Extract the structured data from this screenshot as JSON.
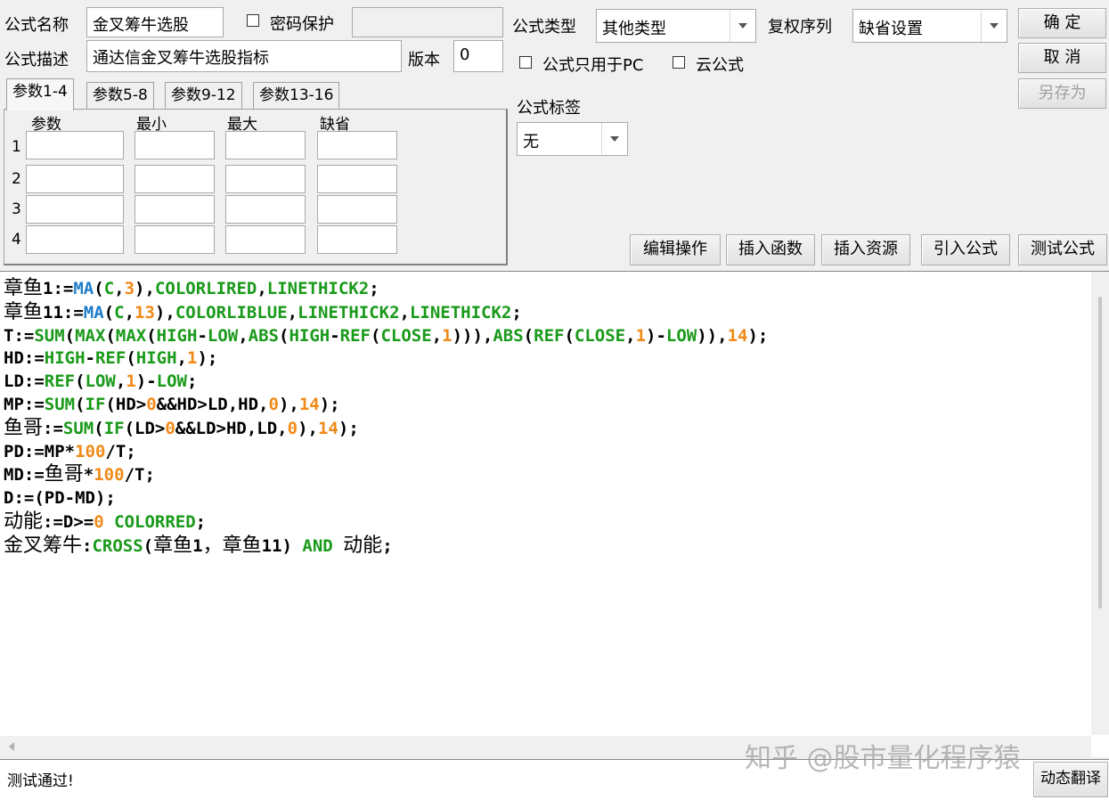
{
  "header": {
    "name_label": "公式名称",
    "name_value": "金叉筹牛选股",
    "password_label": "密码保护",
    "desc_label": "公式描述",
    "desc_value": "通达信金叉筹牛选股指标",
    "version_label": "版本",
    "version_value": "0",
    "type_label": "公式类型",
    "type_value": "其他类型",
    "restore_label": "复权序列",
    "restore_value": "缺省设置",
    "pc_only_label": "公式只用于PC",
    "cloud_label": "云公式",
    "tag_label": "公式标签",
    "tag_value": "无"
  },
  "buttons": {
    "ok": "确  定",
    "cancel": "取  消",
    "save_as": "另存为",
    "edit_ops": "编辑操作",
    "insert_func": "插入函数",
    "insert_res": "插入资源",
    "import_formula": "引入公式",
    "test_formula": "测试公式",
    "dynamic_translate": "动态翻译"
  },
  "tabs": [
    "参数1-4",
    "参数5-8",
    "参数9-12",
    "参数13-16"
  ],
  "params": {
    "columns": [
      "参数",
      "最小",
      "最大",
      "缺省"
    ],
    "rows": [
      "1",
      "2",
      "3",
      "4"
    ]
  },
  "code": {
    "lines": [
      [
        [
          "章鱼",
          "cn"
        ],
        [
          "1:=",
          "id"
        ],
        [
          "MA",
          "blue"
        ],
        [
          "(",
          "id"
        ],
        [
          "C",
          "fn"
        ],
        [
          ",",
          "id"
        ],
        [
          "3",
          "num"
        ],
        [
          ")",
          "id"
        ],
        [
          ",",
          "id"
        ],
        [
          "COLORLIRED",
          "fn"
        ],
        [
          ",",
          "id"
        ],
        [
          "LINETHICK2",
          "fn"
        ],
        [
          ";",
          "id"
        ]
      ],
      [
        [
          "章鱼",
          "cn"
        ],
        [
          "11:=",
          "id"
        ],
        [
          "MA",
          "blue"
        ],
        [
          "(",
          "id"
        ],
        [
          "C",
          "fn"
        ],
        [
          ",",
          "id"
        ],
        [
          "13",
          "num"
        ],
        [
          ")",
          "id"
        ],
        [
          ",",
          "id"
        ],
        [
          "COLORLIBLUE",
          "fn"
        ],
        [
          ",",
          "id"
        ],
        [
          "LINETHICK2",
          "fn"
        ],
        [
          ",",
          "id"
        ],
        [
          "LINETHICK2",
          "fn"
        ],
        [
          ";",
          "id"
        ]
      ],
      [
        [
          "T:=",
          "id"
        ],
        [
          "SUM",
          "fn"
        ],
        [
          "(",
          "id"
        ],
        [
          "MAX",
          "fn"
        ],
        [
          "(",
          "id"
        ],
        [
          "MAX",
          "fn"
        ],
        [
          "(",
          "id"
        ],
        [
          "HIGH",
          "fn"
        ],
        [
          "-",
          "id"
        ],
        [
          "LOW",
          "fn"
        ],
        [
          ",",
          "id"
        ],
        [
          "ABS",
          "fn"
        ],
        [
          "(",
          "id"
        ],
        [
          "HIGH",
          "fn"
        ],
        [
          "-",
          "id"
        ],
        [
          "REF",
          "fn"
        ],
        [
          "(",
          "id"
        ],
        [
          "CLOSE",
          "fn"
        ],
        [
          ",",
          "id"
        ],
        [
          "1",
          "num"
        ],
        [
          ")))",
          "id"
        ],
        [
          ",",
          "id"
        ],
        [
          "ABS",
          "fn"
        ],
        [
          "(",
          "id"
        ],
        [
          "REF",
          "fn"
        ],
        [
          "(",
          "id"
        ],
        [
          "CLOSE",
          "fn"
        ],
        [
          ",",
          "id"
        ],
        [
          "1",
          "num"
        ],
        [
          ")-",
          "id"
        ],
        [
          "LOW",
          "fn"
        ],
        [
          ")),",
          "id"
        ],
        [
          "14",
          "num"
        ],
        [
          ");",
          "id"
        ]
      ],
      [
        [
          "HD:=",
          "id"
        ],
        [
          "HIGH",
          "fn"
        ],
        [
          "-",
          "id"
        ],
        [
          "REF",
          "fn"
        ],
        [
          "(",
          "id"
        ],
        [
          "HIGH",
          "fn"
        ],
        [
          ",",
          "id"
        ],
        [
          "1",
          "num"
        ],
        [
          ");",
          "id"
        ]
      ],
      [
        [
          "LD:=",
          "id"
        ],
        [
          "REF",
          "fn"
        ],
        [
          "(",
          "id"
        ],
        [
          "LOW",
          "fn"
        ],
        [
          ",",
          "id"
        ],
        [
          "1",
          "num"
        ],
        [
          ")-",
          "id"
        ],
        [
          "LOW",
          "fn"
        ],
        [
          ";",
          "id"
        ]
      ],
      [
        [
          "MP:=",
          "id"
        ],
        [
          "SUM",
          "fn"
        ],
        [
          "(",
          "id"
        ],
        [
          "IF",
          "fn"
        ],
        [
          "(HD>",
          "id"
        ],
        [
          "0",
          "num"
        ],
        [
          "&&HD>LD,HD,",
          "id"
        ],
        [
          "0",
          "num"
        ],
        [
          "),",
          "id"
        ],
        [
          "14",
          "num"
        ],
        [
          ");",
          "id"
        ]
      ],
      [
        [
          "鱼哥",
          "cn"
        ],
        [
          ":=",
          "id"
        ],
        [
          "SUM",
          "fn"
        ],
        [
          "(",
          "id"
        ],
        [
          "IF",
          "fn"
        ],
        [
          "(LD>",
          "id"
        ],
        [
          "0",
          "num"
        ],
        [
          "&&LD>HD,LD,",
          "id"
        ],
        [
          "0",
          "num"
        ],
        [
          "),",
          "id"
        ],
        [
          "14",
          "num"
        ],
        [
          ");",
          "id"
        ]
      ],
      [
        [
          "PD:=MP*",
          "id"
        ],
        [
          "100",
          "num"
        ],
        [
          "/T;",
          "id"
        ]
      ],
      [
        [
          "MD:=",
          "id"
        ],
        [
          "鱼哥",
          "cn"
        ],
        [
          "*",
          "id"
        ],
        [
          "100",
          "num"
        ],
        [
          "/T;",
          "id"
        ]
      ],
      [
        [
          "D:=(PD-MD);",
          "id"
        ]
      ],
      [
        [
          "动能",
          "cn"
        ],
        [
          ":=D>=",
          "id"
        ],
        [
          "0",
          "num"
        ],
        [
          " ",
          "id"
        ],
        [
          "COLORRED",
          "fn"
        ],
        [
          ";",
          "id"
        ]
      ],
      [
        [
          "金叉筹牛",
          "cn"
        ],
        [
          ":",
          "id"
        ],
        [
          "CROSS",
          "fn"
        ],
        [
          "(",
          "id"
        ],
        [
          "章鱼",
          "cn"
        ],
        [
          "1",
          "id"
        ],
        [
          "，",
          "cn"
        ],
        [
          "章鱼",
          "cn"
        ],
        [
          "11) ",
          "id"
        ],
        [
          "AND",
          "fn"
        ],
        [
          " ",
          "id"
        ],
        [
          "动能",
          "cn"
        ],
        [
          ";",
          "id"
        ]
      ]
    ]
  },
  "status": {
    "message": "测试通过!"
  },
  "watermark": "知乎 @股市量化程序猿"
}
